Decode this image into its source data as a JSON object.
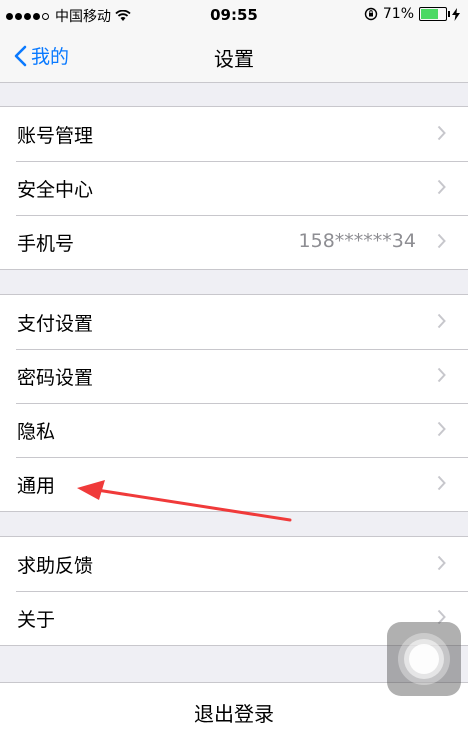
{
  "status_bar": {
    "carrier": "中国移动",
    "time": "09:55",
    "battery": "71%",
    "battery_level": 0.71,
    "signal_bars_filled": 4,
    "icons": [
      "wifi-icon",
      "orientation-lock-icon",
      "charging-icon"
    ]
  },
  "navbar": {
    "back_label": "我的",
    "title": "设置"
  },
  "groups": [
    {
      "items": [
        {
          "label": "账号管理",
          "value": ""
        },
        {
          "label": "安全中心",
          "value": ""
        },
        {
          "label": "手机号",
          "value": "158******34"
        }
      ]
    },
    {
      "items": [
        {
          "label": "支付设置",
          "value": ""
        },
        {
          "label": "密码设置",
          "value": ""
        },
        {
          "label": "隐私",
          "value": ""
        },
        {
          "label": "通用",
          "value": ""
        }
      ]
    },
    {
      "items": [
        {
          "label": "求助反馈",
          "value": ""
        },
        {
          "label": "关于",
          "value": ""
        }
      ]
    }
  ],
  "logout_label": "退出登录",
  "colors": {
    "accent": "#0a7aff",
    "annotation": "#f03a3a",
    "battery": "#4cd964",
    "background": "#efeff4"
  }
}
